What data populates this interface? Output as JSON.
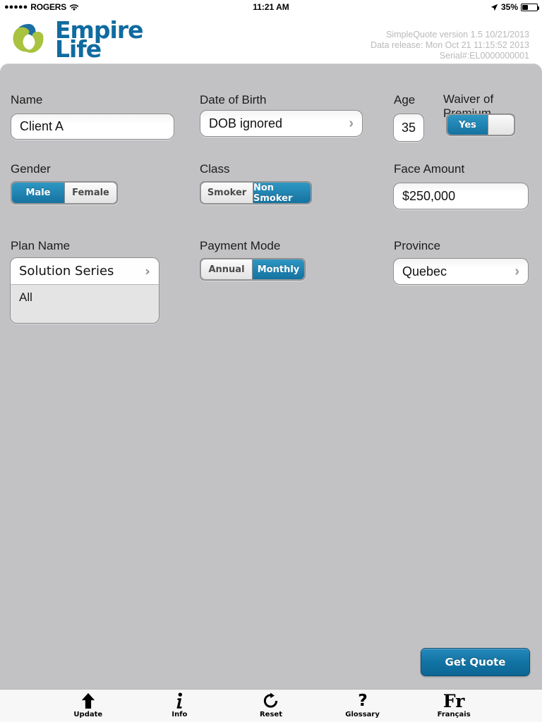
{
  "status_bar": {
    "signal_dots": "●●●●●",
    "carrier": "ROGERS",
    "wifi_icon": "wifi-icon",
    "time": "11:21 AM",
    "location_icon": "location-arrow-icon",
    "battery_percent": "35%",
    "battery_level": 35
  },
  "header": {
    "logo_name": "Empire Life",
    "logo_line1": "Empire",
    "logo_line2": "Life",
    "logo_green": "#a9c23f",
    "logo_blue": "#1b6fa3",
    "version_line1": "SimpleQuote version 1.5 10/21/2013",
    "version_line2": "Data release: Mon Oct 21 11:15:52 2013",
    "version_line3": "Serial#:EL0000000001"
  },
  "form": {
    "name": {
      "label": "Name",
      "value": "Client A"
    },
    "dob": {
      "label": "Date of Birth",
      "value": "DOB ignored",
      "chevron": "›"
    },
    "age": {
      "label": "Age",
      "value": "35"
    },
    "waiver": {
      "label": "Waiver of Premium",
      "options": [
        "Yes",
        ""
      ],
      "selected_index": 0
    },
    "gender": {
      "label": "Gender",
      "options": [
        "Male",
        "Female"
      ],
      "selected_index": 0
    },
    "class": {
      "label": "Class",
      "options": [
        "Smoker",
        "Non Smoker"
      ],
      "selected_index": 1
    },
    "face_amount": {
      "label": "Face Amount",
      "value": "$250,000"
    },
    "plan_name": {
      "label": "Plan Name",
      "value": "Solution Series",
      "chevron": "›",
      "options": [
        "All"
      ]
    },
    "payment_mode": {
      "label": "Payment Mode",
      "options": [
        "Annual",
        "Monthly"
      ],
      "selected_index": 1
    },
    "province": {
      "label": "Province",
      "value": "Quebec",
      "chevron": "›"
    }
  },
  "actions": {
    "get_quote_label": "Get Quote",
    "get_quote_color": "#1173a3"
  },
  "tabbar": {
    "items": [
      {
        "label": "Update",
        "icon": "upload-arrow-icon"
      },
      {
        "label": "Info",
        "icon": "info-icon"
      },
      {
        "label": "Reset",
        "icon": "refresh-icon"
      },
      {
        "label": "Glossary",
        "icon": "question-mark-icon"
      },
      {
        "label": "Français",
        "icon": "fr-language-icon"
      }
    ]
  }
}
